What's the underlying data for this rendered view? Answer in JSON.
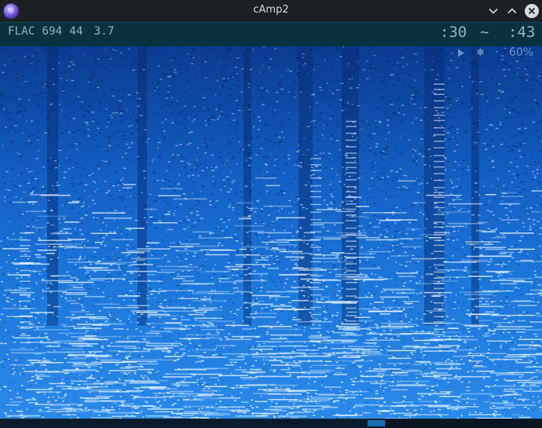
{
  "window": {
    "title": "cAmp2",
    "app_icon": "camp-logo-icon",
    "controls": [
      "chevron-down-icon",
      "chevron-up-icon",
      "close-icon"
    ]
  },
  "info_bar": {
    "codec": "FLAC",
    "bitrate": "694",
    "sample_rate": "44",
    "size": "3.7",
    "position": ":30",
    "separator": "~",
    "duration": ":43"
  },
  "overlay": {
    "play_icon": "play-icon",
    "star_icon": "star-icon",
    "star_glyph": "✱",
    "volume": "60%"
  },
  "seek": {
    "progress": 0.7
  },
  "colors": {
    "titlebar": "#1c2024",
    "infobar": "#08323e",
    "info_text": "#8fb6c7",
    "spectrum_low": "#0a3f9e",
    "spectrum_mid": "#1a72d8",
    "spectrum_high": "#e8f4ff",
    "seek_handle": "#1c6fb5"
  }
}
